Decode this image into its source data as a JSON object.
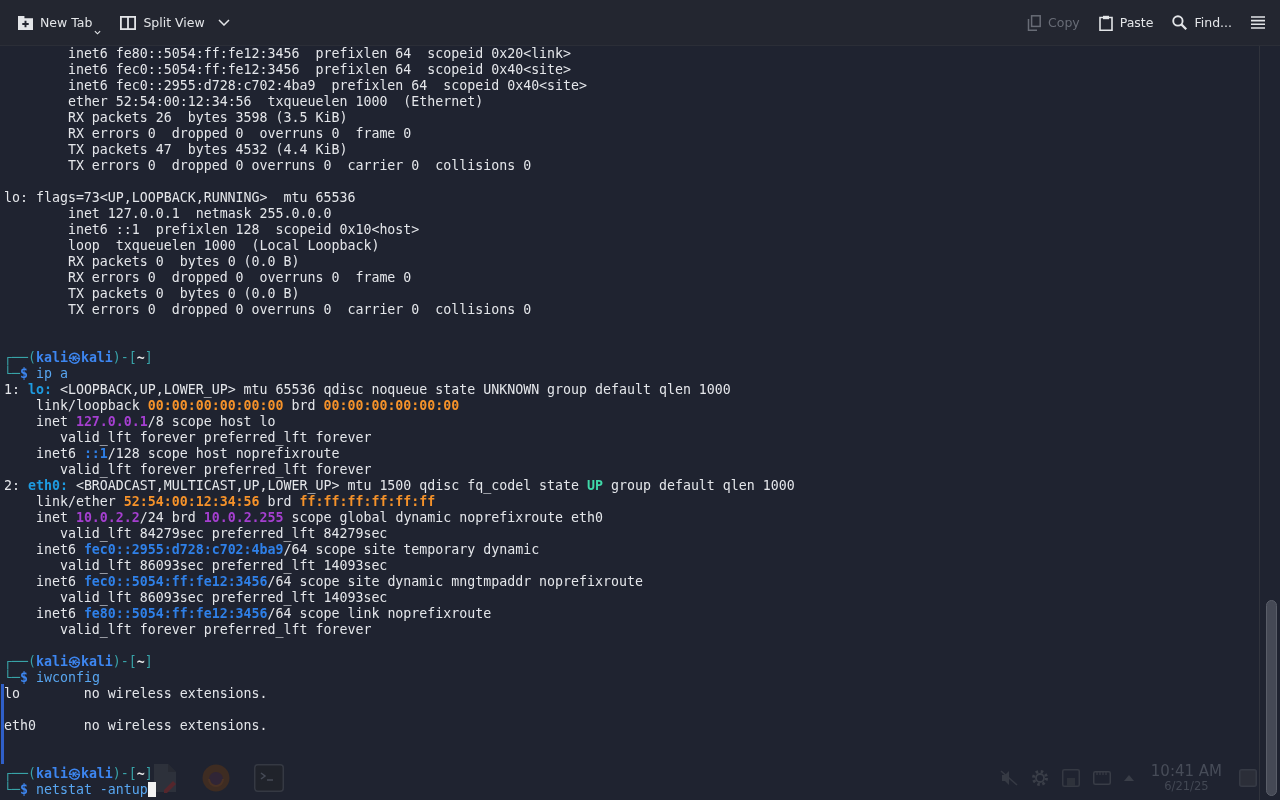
{
  "toolbar": {
    "left": [
      {
        "kind": "new-tab",
        "label": "New Tab",
        "menu": true,
        "disabled": false
      },
      {
        "kind": "split-view",
        "label": "Split View",
        "menu": true,
        "disabled": false
      }
    ],
    "right": [
      {
        "kind": "copy",
        "label": "Copy",
        "menu": false,
        "disabled": true
      },
      {
        "kind": "paste",
        "label": "Paste",
        "menu": false,
        "disabled": false
      },
      {
        "kind": "find",
        "label": "Find...",
        "menu": false,
        "disabled": false
      },
      {
        "kind": "menu",
        "menu": false,
        "disabled": false
      }
    ]
  },
  "terminal": {
    "cursor": true,
    "lines": [
      {
        "kind": "output",
        "segments": [
          {
            "text": "        inet6 fe80::5054:ff:fe12:3456  prefixlen 64  scopeid 0x20<link>",
            "kind": "text"
          }
        ]
      },
      {
        "kind": "output",
        "segments": [
          {
            "text": "        inet6 fec0::5054:ff:fe12:3456  prefixlen 64  scopeid 0x40<site>",
            "kind": "text"
          }
        ]
      },
      {
        "kind": "output",
        "segments": [
          {
            "text": "        inet6 fec0::2955:d728:c702:4ba9  prefixlen 64  scopeid 0x40<site>",
            "kind": "text"
          }
        ]
      },
      {
        "kind": "output",
        "segments": [
          {
            "text": "        ether 52:54:00:12:34:56  txqueuelen 1000  (Ethernet)",
            "kind": "text"
          }
        ]
      },
      {
        "kind": "output",
        "segments": [
          {
            "text": "        RX packets 26  bytes 3598 (3.5 KiB)",
            "kind": "text"
          }
        ]
      },
      {
        "kind": "output",
        "segments": [
          {
            "text": "        RX errors 0  dropped 0  overruns 0  frame 0",
            "kind": "text"
          }
        ]
      },
      {
        "kind": "output",
        "segments": [
          {
            "text": "        TX packets 47  bytes 4532 (4.4 KiB)",
            "kind": "text"
          }
        ]
      },
      {
        "kind": "output",
        "segments": [
          {
            "text": "        TX errors 0  dropped 0 overruns 0  carrier 0  collisions 0",
            "kind": "text"
          }
        ]
      },
      {
        "kind": "blank"
      },
      {
        "kind": "output",
        "segments": [
          {
            "text": "lo: flags=73<UP,LOOPBACK,RUNNING>  mtu 65536",
            "kind": "text"
          }
        ]
      },
      {
        "kind": "output",
        "segments": [
          {
            "text": "        inet 127.0.0.1  netmask 255.0.0.0",
            "kind": "text"
          }
        ]
      },
      {
        "kind": "output",
        "segments": [
          {
            "text": "        inet6 ::1  prefixlen 128  scopeid 0x10<host>",
            "kind": "text"
          }
        ]
      },
      {
        "kind": "output",
        "segments": [
          {
            "text": "        loop  txqueuelen 1000  (Local Loopback)",
            "kind": "text"
          }
        ]
      },
      {
        "kind": "output",
        "segments": [
          {
            "text": "        RX packets 0  bytes 0 (0.0 B)",
            "kind": "text"
          }
        ]
      },
      {
        "kind": "output",
        "segments": [
          {
            "text": "        RX errors 0  dropped 0  overruns 0  frame 0",
            "kind": "text"
          }
        ]
      },
      {
        "kind": "output",
        "segments": [
          {
            "text": "        TX packets 0  bytes 0 (0.0 B)",
            "kind": "text"
          }
        ]
      },
      {
        "kind": "output",
        "segments": [
          {
            "text": "        TX errors 0  dropped 0 overruns 0  carrier 0  collisions 0",
            "kind": "text"
          }
        ]
      },
      {
        "kind": "blank"
      },
      {
        "kind": "blank"
      },
      {
        "kind": "prompt",
        "segments": [
          {
            "text": "┌──(",
            "kind": "frame"
          },
          {
            "text": "kali㉿kali",
            "kind": "user"
          },
          {
            "text": ")-[",
            "kind": "frame"
          },
          {
            "text": "~",
            "kind": "path"
          },
          {
            "text": "]",
            "kind": "frame"
          }
        ]
      },
      {
        "kind": "command",
        "segments": [
          {
            "text": "└─",
            "kind": "frame"
          },
          {
            "text": "$",
            "kind": "sign"
          },
          {
            "text": " ip a",
            "kind": "command"
          }
        ]
      },
      {
        "kind": "output",
        "segments": [
          {
            "text": "1: ",
            "kind": "text"
          },
          {
            "text": "lo:",
            "kind": "iface"
          },
          {
            "text": " <LOOPBACK,UP,LOWER_UP> mtu 65536 qdisc noqueue state UNKNOWN group default qlen 1000",
            "kind": "text"
          }
        ]
      },
      {
        "kind": "output",
        "segments": [
          {
            "text": "    link/loopback ",
            "kind": "text"
          },
          {
            "text": "00:00:00:00:00:00",
            "kind": "mac"
          },
          {
            "text": " brd ",
            "kind": "text"
          },
          {
            "text": "00:00:00:00:00:00",
            "kind": "mac"
          }
        ]
      },
      {
        "kind": "output",
        "segments": [
          {
            "text": "    inet ",
            "kind": "text"
          },
          {
            "text": "127.0.0.1",
            "kind": "ipv4"
          },
          {
            "text": "/8 scope host lo",
            "kind": "text"
          }
        ]
      },
      {
        "kind": "output",
        "segments": [
          {
            "text": "       valid_lft forever preferred_lft forever",
            "kind": "text"
          }
        ]
      },
      {
        "kind": "output",
        "segments": [
          {
            "text": "    inet6 ",
            "kind": "text"
          },
          {
            "text": "::1",
            "kind": "ipv6"
          },
          {
            "text": "/128 scope host noprefixroute",
            "kind": "text"
          }
        ]
      },
      {
        "kind": "output",
        "segments": [
          {
            "text": "       valid_lft forever preferred_lft forever",
            "kind": "text"
          }
        ]
      },
      {
        "kind": "output",
        "segments": [
          {
            "text": "2: ",
            "kind": "text"
          },
          {
            "text": "eth0:",
            "kind": "iface"
          },
          {
            "text": " <BROADCAST,MULTICAST,UP,LOWER_UP> mtu 1500 qdisc fq_codel state ",
            "kind": "text"
          },
          {
            "text": "UP",
            "kind": "state"
          },
          {
            "text": " group default qlen 1000",
            "kind": "text"
          }
        ]
      },
      {
        "kind": "output",
        "segments": [
          {
            "text": "    link/ether ",
            "kind": "text"
          },
          {
            "text": "52:54:00:12:34:56",
            "kind": "mac"
          },
          {
            "text": " brd ",
            "kind": "text"
          },
          {
            "text": "ff:ff:ff:ff:ff:ff",
            "kind": "mac"
          }
        ]
      },
      {
        "kind": "output",
        "segments": [
          {
            "text": "    inet ",
            "kind": "text"
          },
          {
            "text": "10.0.2.2",
            "kind": "ipv4"
          },
          {
            "text": "/24 brd ",
            "kind": "text"
          },
          {
            "text": "10.0.2.255",
            "kind": "ipv4"
          },
          {
            "text": " scope global dynamic noprefixroute eth0",
            "kind": "text"
          }
        ]
      },
      {
        "kind": "output",
        "segments": [
          {
            "text": "       valid_lft 84279sec preferred_lft 84279sec",
            "kind": "text"
          }
        ]
      },
      {
        "kind": "output",
        "segments": [
          {
            "text": "    inet6 ",
            "kind": "text"
          },
          {
            "text": "fec0::2955:d728:c702:4ba9",
            "kind": "ipv6"
          },
          {
            "text": "/64 scope site temporary dynamic",
            "kind": "text"
          }
        ]
      },
      {
        "kind": "output",
        "segments": [
          {
            "text": "       valid_lft 86093sec preferred_lft 14093sec",
            "kind": "text"
          }
        ]
      },
      {
        "kind": "output",
        "segments": [
          {
            "text": "    inet6 ",
            "kind": "text"
          },
          {
            "text": "fec0::5054:ff:fe12:3456",
            "kind": "ipv6"
          },
          {
            "text": "/64 scope site dynamic mngtmpaddr noprefixroute",
            "kind": "text"
          }
        ]
      },
      {
        "kind": "output",
        "segments": [
          {
            "text": "       valid_lft 86093sec preferred_lft 14093sec",
            "kind": "text"
          }
        ]
      },
      {
        "kind": "output",
        "segments": [
          {
            "text": "    inet6 ",
            "kind": "text"
          },
          {
            "text": "fe80::5054:ff:fe12:3456",
            "kind": "ipv6"
          },
          {
            "text": "/64 scope link noprefixroute",
            "kind": "text"
          }
        ]
      },
      {
        "kind": "output",
        "segments": [
          {
            "text": "       valid_lft forever preferred_lft forever",
            "kind": "text"
          }
        ]
      },
      {
        "kind": "blank"
      },
      {
        "kind": "prompt",
        "segments": [
          {
            "text": "┌──(",
            "kind": "frame"
          },
          {
            "text": "kali㉿kali",
            "kind": "user"
          },
          {
            "text": ")-[",
            "kind": "frame"
          },
          {
            "text": "~",
            "kind": "path"
          },
          {
            "text": "]",
            "kind": "frame"
          }
        ]
      },
      {
        "kind": "command",
        "segments": [
          {
            "text": "└─",
            "kind": "frame"
          },
          {
            "text": "$",
            "kind": "sign"
          },
          {
            "text": " iwconfig",
            "kind": "command"
          }
        ]
      },
      {
        "kind": "output",
        "segments": [
          {
            "text": "lo        no wireless extensions.",
            "kind": "text"
          }
        ]
      },
      {
        "kind": "blank"
      },
      {
        "kind": "output",
        "segments": [
          {
            "text": "eth0      no wireless extensions.",
            "kind": "text"
          }
        ]
      },
      {
        "kind": "blank"
      },
      {
        "kind": "blank"
      },
      {
        "kind": "prompt",
        "segments": [
          {
            "text": "┌──(",
            "kind": "frame"
          },
          {
            "text": "kali㉿kali",
            "kind": "user"
          },
          {
            "text": ")-[",
            "kind": "frame"
          },
          {
            "text": "~",
            "kind": "path"
          },
          {
            "text": "]",
            "kind": "frame"
          }
        ]
      },
      {
        "kind": "command",
        "segments": [
          {
            "text": "└─",
            "kind": "frame"
          },
          {
            "text": "$",
            "kind": "sign"
          },
          {
            "text": " netstat -antup",
            "kind": "command"
          }
        ]
      }
    ]
  },
  "taskbar": {
    "launchers": [
      {
        "kind": "text-editor"
      },
      {
        "kind": "browser"
      },
      {
        "kind": "terminal"
      }
    ],
    "tray": [
      {
        "kind": "muted-speaker"
      },
      {
        "kind": "gear"
      },
      {
        "kind": "storage"
      },
      {
        "kind": "display"
      },
      {
        "kind": "expand"
      }
    ],
    "clock": {
      "time": "10:41 AM",
      "date": "6/21/25"
    },
    "corner": [
      {
        "kind": "desktop"
      }
    ]
  }
}
